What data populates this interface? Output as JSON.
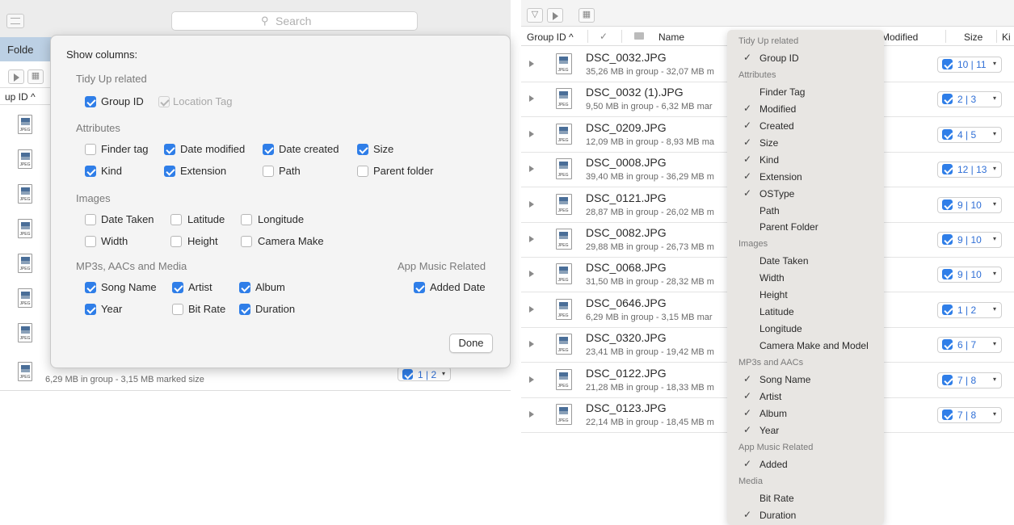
{
  "left": {
    "search_placeholder": "Search",
    "folder_tab": "Folde",
    "group_id_header": "up ID ^",
    "last_row_sub": "6,29 MB in group - 3,15 MB marked size",
    "last_row_group": "1 | 2"
  },
  "dialog": {
    "title": "Show columns:",
    "sections": {
      "tidy": "Tidy Up related",
      "attributes": "Attributes",
      "images": "Images",
      "media": "MP3s, AACs and Media",
      "app_music": "App Music Related"
    },
    "options": {
      "group_id": "Group ID",
      "location_tag": "Location Tag",
      "finder_tag": "Finder tag",
      "date_modified": "Date modified",
      "date_created": "Date created",
      "size": "Size",
      "kind": "Kind",
      "extension": "Extension",
      "path": "Path",
      "parent_folder": "Parent folder",
      "date_taken": "Date Taken",
      "latitude": "Latitude",
      "longitude": "Longitude",
      "width": "Width",
      "height": "Height",
      "camera_make": "Camera Make",
      "song_name": "Song Name",
      "artist": "Artist",
      "album": "Album",
      "added_date": "Added Date",
      "year": "Year",
      "bit_rate": "Bit Rate",
      "duration": "Duration"
    },
    "done_label": "Done"
  },
  "right": {
    "columns": {
      "group_id": "Group ID ^",
      "check": "✓",
      "name": "Name",
      "modified": "Modified",
      "size": "Size",
      "kind": "Ki"
    },
    "file_kind_label": "JPEG",
    "rows": [
      {
        "name": "DSC_0032.JPG",
        "sub": "35,26 MB in group - 32,07 MB m",
        "group": "10 | 11"
      },
      {
        "name": "DSC_0032 (1).JPG",
        "sub": "9,50 MB in group - 6,32 MB mar",
        "group": "2 | 3"
      },
      {
        "name": "DSC_0209.JPG",
        "sub": "12,09 MB in group - 8,93 MB ma",
        "group": "4 | 5"
      },
      {
        "name": "DSC_0008.JPG",
        "sub": "39,40 MB in group - 36,29 MB m",
        "group": "12 | 13"
      },
      {
        "name": "DSC_0121.JPG",
        "sub": "28,87 MB in group - 26,02 MB m",
        "group": "9 | 10"
      },
      {
        "name": "DSC_0082.JPG",
        "sub": "29,88 MB in group - 26,73 MB m",
        "group": "9 | 10"
      },
      {
        "name": "DSC_0068.JPG",
        "sub": "31,50 MB in group - 28,32 MB m",
        "group": "9 | 10"
      },
      {
        "name": "DSC_0646.JPG",
        "sub": "6,29 MB in group - 3,15 MB mar",
        "group": "1 | 2"
      },
      {
        "name": "DSC_0320.JPG",
        "sub": "23,41 MB in group - 19,42 MB m",
        "group": "6 | 7"
      },
      {
        "name": "DSC_0122.JPG",
        "sub": "21,28 MB in group - 18,33 MB m",
        "group": "7 | 8"
      },
      {
        "name": "DSC_0123.JPG",
        "sub": "22,14 MB in group - 18,45 MB m",
        "group": "7 | 8"
      }
    ],
    "menu": [
      {
        "type": "header",
        "label": "Tidy Up related"
      },
      {
        "type": "item",
        "label": "Group ID",
        "checked": true
      },
      {
        "type": "header",
        "label": "Attributes"
      },
      {
        "type": "item",
        "label": "Finder Tag",
        "checked": false
      },
      {
        "type": "item",
        "label": "Modified",
        "checked": true
      },
      {
        "type": "item",
        "label": "Created",
        "checked": true
      },
      {
        "type": "item",
        "label": "Size",
        "checked": true
      },
      {
        "type": "item",
        "label": "Kind",
        "checked": true
      },
      {
        "type": "item",
        "label": "Extension",
        "checked": true
      },
      {
        "type": "item",
        "label": "OSType",
        "checked": true
      },
      {
        "type": "item",
        "label": "Path",
        "checked": false
      },
      {
        "type": "item",
        "label": "Parent Folder",
        "checked": false
      },
      {
        "type": "header",
        "label": "Images"
      },
      {
        "type": "item",
        "label": "Date Taken",
        "checked": false
      },
      {
        "type": "item",
        "label": "Width",
        "checked": false
      },
      {
        "type": "item",
        "label": "Height",
        "checked": false
      },
      {
        "type": "item",
        "label": "Latitude",
        "checked": false
      },
      {
        "type": "item",
        "label": "Longitude",
        "checked": false
      },
      {
        "type": "item",
        "label": "Camera Make and Model",
        "checked": false
      },
      {
        "type": "header",
        "label": "MP3s and AACs"
      },
      {
        "type": "item",
        "label": "Song Name",
        "checked": true
      },
      {
        "type": "item",
        "label": "Artist",
        "checked": true
      },
      {
        "type": "item",
        "label": "Album",
        "checked": true
      },
      {
        "type": "item",
        "label": "Year",
        "checked": true
      },
      {
        "type": "header",
        "label": "App Music Related"
      },
      {
        "type": "item",
        "label": "Added",
        "checked": true
      },
      {
        "type": "header",
        "label": "Media"
      },
      {
        "type": "item",
        "label": "Bit Rate",
        "checked": false
      },
      {
        "type": "item",
        "label": "Duration",
        "checked": true
      }
    ]
  },
  "colors": {
    "accent": "#2f7ee8",
    "menu_bg": "#e8e6e3",
    "group_text": "#2f6fd6"
  }
}
